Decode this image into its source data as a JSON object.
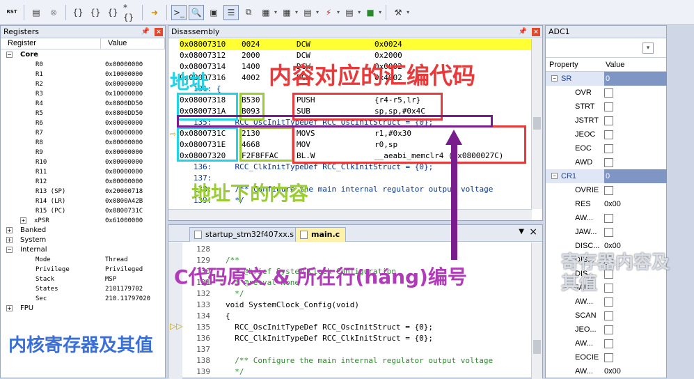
{
  "toolbar": {
    "rst_label": "RST",
    "items": [
      "reset",
      "run",
      "stop",
      "step",
      "step-over",
      "step-out",
      "run-to-cursor",
      "show-next",
      "command-window",
      "disassembly-window",
      "symbols-window",
      "registers-window",
      "call-stack-window",
      "watch-window",
      "memory-window",
      "serial-window",
      "analysis-window",
      "trace-window",
      "system-viewer",
      "toolbox"
    ]
  },
  "registers": {
    "title": "Registers",
    "col_register": "Register",
    "col_value": "Value",
    "core_label": "Core",
    "rows": [
      {
        "name": "R0",
        "value": "0x00000000"
      },
      {
        "name": "R1",
        "value": "0x10000000"
      },
      {
        "name": "R2",
        "value": "0x00000000"
      },
      {
        "name": "R3",
        "value": "0x10000000"
      },
      {
        "name": "R4",
        "value": "0x0800DD50"
      },
      {
        "name": "R5",
        "value": "0x0800DD50"
      },
      {
        "name": "R6",
        "value": "0x00000000"
      },
      {
        "name": "R7",
        "value": "0x00000000"
      },
      {
        "name": "R8",
        "value": "0x00000000"
      },
      {
        "name": "R9",
        "value": "0x00000000"
      },
      {
        "name": "R10",
        "value": "0x00000000"
      },
      {
        "name": "R11",
        "value": "0x00000000"
      },
      {
        "name": "R12",
        "value": "0x00000000"
      },
      {
        "name": "R13 (SP)",
        "value": "0x20000718"
      },
      {
        "name": "R14 (LR)",
        "value": "0x0800A42B"
      },
      {
        "name": "R15 (PC)",
        "value": "0x0800731C"
      },
      {
        "name": "xPSR",
        "value": "0x61000000"
      }
    ],
    "banked": "Banked",
    "system": "System",
    "internal": "Internal",
    "internal_rows": [
      {
        "name": "Mode",
        "value": "Thread"
      },
      {
        "name": "Privilege",
        "value": "Privileged"
      },
      {
        "name": "Stack",
        "value": "MSP"
      },
      {
        "name": "States",
        "value": "2101179702"
      },
      {
        "name": "Sec",
        "value": "210.11797020"
      }
    ],
    "fpu": "FPU"
  },
  "disassembly": {
    "title": "Disassembly",
    "lines": [
      {
        "addr": "0x08007310",
        "code": "0024",
        "mn": "DCW",
        "op": "0x0024",
        "hl": true
      },
      {
        "addr": "0x08007312",
        "code": "2000",
        "mn": "DCW",
        "op": "0x2000"
      },
      {
        "addr": "0x08007314",
        "code": "1400",
        "mn": "DCW",
        "op": "0x0002"
      },
      {
        "addr": "0x08007316",
        "code": "4002",
        "mn": "DCW",
        "op": "0x4002"
      },
      {
        "src": "   131: {"
      },
      {
        "addr": "0x08007318",
        "code": "B530",
        "mn": "PUSH",
        "op": "{r4-r5,lr}"
      },
      {
        "addr": "0x0800731A",
        "code": "B093",
        "mn": "SUB",
        "op": "sp,sp,#0x4C"
      },
      {
        "src": "   135:     RCC_OscInitTypeDef RCC_OscInitStruct = {0};"
      },
      {
        "addr": "0x0800731C",
        "code": "2130",
        "mn": "MOVS",
        "op": "r1,#0x30"
      },
      {
        "addr": "0x0800731E",
        "code": "4668",
        "mn": "MOV",
        "op": "r0,sp"
      },
      {
        "addr": "0x08007320",
        "code": "F2F8FFAC",
        "mn": "BL.W",
        "op": "__aeabi_memclr4 (0x0800027C)"
      },
      {
        "src": "   136:     RCC_ClkInitTypeDef RCC_ClkInitStruct = {0};"
      },
      {
        "src": "   137: "
      },
      {
        "src": "   138:     /** Configure the main internal regulator output voltage"
      },
      {
        "src": "   139:     */"
      }
    ]
  },
  "editor": {
    "tabs": [
      {
        "label": "startup_stm32f407xx.s"
      },
      {
        "label": "main.c"
      }
    ],
    "lines": [
      {
        "n": "128",
        "code": ""
      },
      {
        "n": "129",
        "code": "/**"
      },
      {
        "n": "130",
        "code": "  * @brief System Clock Configuration"
      },
      {
        "n": "131",
        "code": "  * @retval None"
      },
      {
        "n": "132",
        "code": "  */"
      },
      {
        "n": "133",
        "code": "void SystemClock_Config(void)"
      },
      {
        "n": "134",
        "code": "{"
      },
      {
        "n": "135",
        "code": "  RCC_OscInitTypeDef RCC_OscInitStruct = {0};"
      },
      {
        "n": "136",
        "code": "  RCC_ClkInitTypeDef RCC_ClkInitStruct = {0};"
      },
      {
        "n": "137",
        "code": ""
      },
      {
        "n": "138",
        "code": "  /** Configure the main internal regulator output voltage"
      },
      {
        "n": "139",
        "code": "  */"
      }
    ]
  },
  "props": {
    "title": "ADC1",
    "col_property": "Property",
    "col_value": "Value",
    "rows": [
      {
        "name": "SR",
        "value": "0",
        "group": true
      },
      {
        "name": "OVR",
        "cb": true
      },
      {
        "name": "STRT",
        "cb": true
      },
      {
        "name": "JSTRT",
        "cb": true
      },
      {
        "name": "JEOC",
        "cb": true
      },
      {
        "name": "EOC",
        "cb": true
      },
      {
        "name": "AWD",
        "cb": true
      },
      {
        "name": "CR1",
        "value": "0",
        "group": true
      },
      {
        "name": "OVRIE",
        "cb": true
      },
      {
        "name": "RES",
        "value": "0x00"
      },
      {
        "name": "AW...",
        "cb": true
      },
      {
        "name": "JAW...",
        "cb": true
      },
      {
        "name": "DISC...",
        "value": "0x00"
      },
      {
        "name": "DIS...",
        "cb": true
      },
      {
        "name": "DIS...",
        "cb": true
      },
      {
        "name": "JAU...",
        "cb": true
      },
      {
        "name": "AW...",
        "cb": true
      },
      {
        "name": "SCAN",
        "cb": true
      },
      {
        "name": "JEO...",
        "cb": true
      },
      {
        "name": "AW...",
        "cb": true
      },
      {
        "name": "EOCIE",
        "cb": true
      },
      {
        "name": "AW...",
        "value": "0x00"
      }
    ]
  },
  "annotations": {
    "addr": "地址",
    "asm": "内容对应的汇编代码",
    "addr_content": "地址下的内容",
    "csrc": "C代码原文 & 所在行(háng)编号",
    "periph": "寄存器内容及其值",
    "core": "内核寄存器及其值"
  },
  "colors": {
    "cyan": "#22d3e6",
    "green": "#9acd32",
    "red": "#e83a3a",
    "purple": "#7a1d8c",
    "highlight": "#ffff33"
  }
}
